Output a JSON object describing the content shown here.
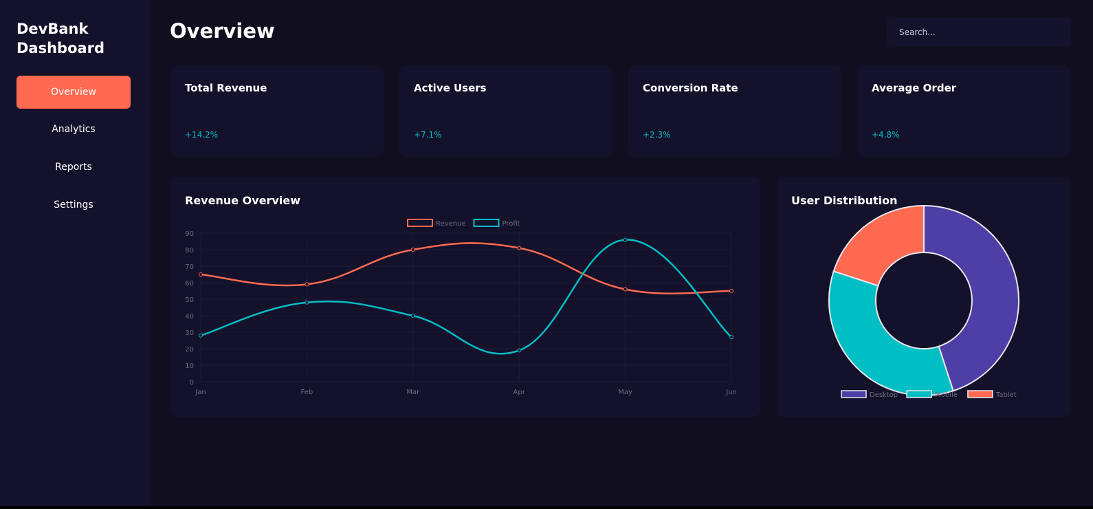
{
  "app": {
    "title": "DevBank Dashboard"
  },
  "sidebar": {
    "items": [
      {
        "label": "Overview",
        "active": true
      },
      {
        "label": "Analytics"
      },
      {
        "label": "Reports"
      },
      {
        "label": "Settings"
      }
    ]
  },
  "header": {
    "title": "Overview",
    "search_placeholder": "Search..."
  },
  "stats": [
    {
      "title": "Total Revenue",
      "change": "+14.2%"
    },
    {
      "title": "Active Users",
      "change": "+7.1%"
    },
    {
      "title": "Conversion Rate",
      "change": "+2.3%"
    },
    {
      "title": "Average Order",
      "change": "+4.8%"
    }
  ],
  "colors": {
    "accent": "#ff6a50",
    "positive": "#00bfc4",
    "desktop": "#4d3fa5",
    "sidebar_bg": "#14112b",
    "main_bg": "#110e1f"
  },
  "revenue_panel": {
    "title": "Revenue Overview"
  },
  "distribution_panel": {
    "title": "User Distribution"
  },
  "chart_data": [
    {
      "type": "line",
      "title": "Revenue Overview",
      "categories": [
        "Jan",
        "Feb",
        "Mar",
        "Apr",
        "May",
        "Jun"
      ],
      "series": [
        {
          "name": "Revenue",
          "values": [
            65,
            59,
            80,
            81,
            56,
            55
          ],
          "color": "#ff6a50"
        },
        {
          "name": "Profit",
          "values": [
            28,
            48,
            40,
            19,
            86,
            27
          ],
          "color": "#00bfc4"
        }
      ],
      "ylim": [
        0,
        90
      ],
      "yticks": [
        0,
        10,
        20,
        30,
        40,
        50,
        60,
        70,
        80,
        90
      ],
      "legend": "top-center",
      "grid": true,
      "smooth": true
    },
    {
      "type": "pie",
      "variant": "doughnut",
      "title": "User Distribution",
      "categories": [
        "Desktop",
        "Mobile",
        "Tablet"
      ],
      "values": [
        45,
        35,
        20
      ],
      "colors": [
        "#4d3fa5",
        "#00bfc4",
        "#ff6a50"
      ],
      "legend": "bottom"
    }
  ]
}
